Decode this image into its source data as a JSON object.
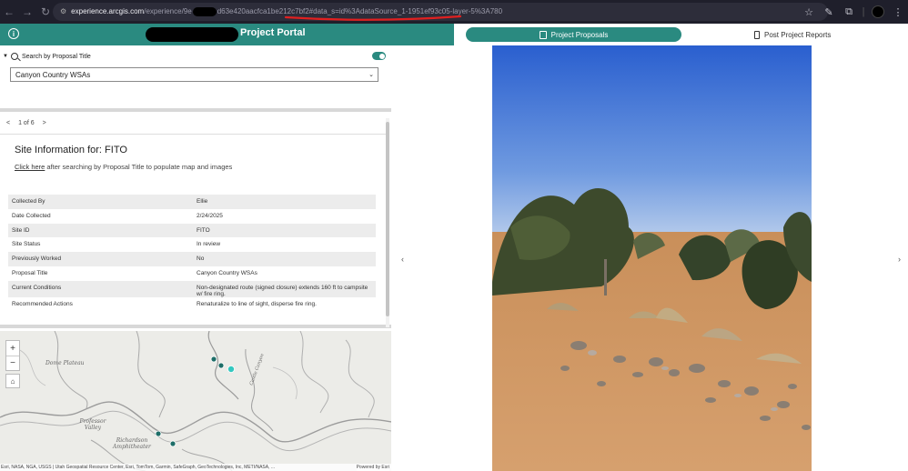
{
  "browser": {
    "url_host": "experience.arcgis.com",
    "url_path": "/experience/9e",
    "url_rest": "d63e420aacfca1be212c7bf2#data_s=id%3AdataSource_1-1951ef93c05-layer-5%3A780",
    "icons": [
      "back-icon",
      "forward-icon",
      "reload-icon",
      "site-info-icon",
      "star-icon",
      "eyedropper-icon",
      "extensions-icon",
      "profile-avatar"
    ]
  },
  "header": {
    "title": "Project Portal",
    "color": "#2a8a80"
  },
  "tabs": {
    "proposals_label": "Project Proposals",
    "reports_label": "Post Project Reports"
  },
  "search": {
    "label": "Search by Proposal Title",
    "selected_value": "Canyon Country WSAs"
  },
  "pager": {
    "prev": "<",
    "position": "1 of 6",
    "next": ">"
  },
  "site": {
    "heading": "Site Information for: FITO",
    "click_link": "Click here",
    "click_rest": " after searching by Proposal Title to populate map and images"
  },
  "table": [
    {
      "key": "Collected By",
      "value": "Ellie"
    },
    {
      "key": "Date Collected",
      "value": "2/24/2025"
    },
    {
      "key": "Site ID",
      "value": "FITO"
    },
    {
      "key": "Site Status",
      "value": "In review"
    },
    {
      "key": "Previously Worked",
      "value": "No"
    },
    {
      "key": "Proposal Title",
      "value": "Canyon Country WSAs"
    },
    {
      "key": "Current Conditions",
      "value": "Non-designated route (signed closure) extends 160 ft to campsite w/ fire ring."
    },
    {
      "key": "Recommended Actions",
      "value": "Renaturalize to line of sight, disperse fire ring."
    }
  ],
  "map": {
    "zoom_in": "+",
    "zoom_out": "−",
    "label_dome": "Dome Plateau",
    "label_professor": "Professor Valley",
    "label_richardson": "Richardson Amphitheater",
    "label_canyon": "Castle Canyon",
    "attribution": "Esri, NASA, NGA, USGS | Utah Geospatial Resource Center, Esri, TomTom, Garmin, SafeGraph, GeoTechnologies, Inc, METI/NASA, ...",
    "powered": "Powered by Esri"
  },
  "photo": {
    "nav_prev": "‹",
    "nav_next": "›"
  }
}
